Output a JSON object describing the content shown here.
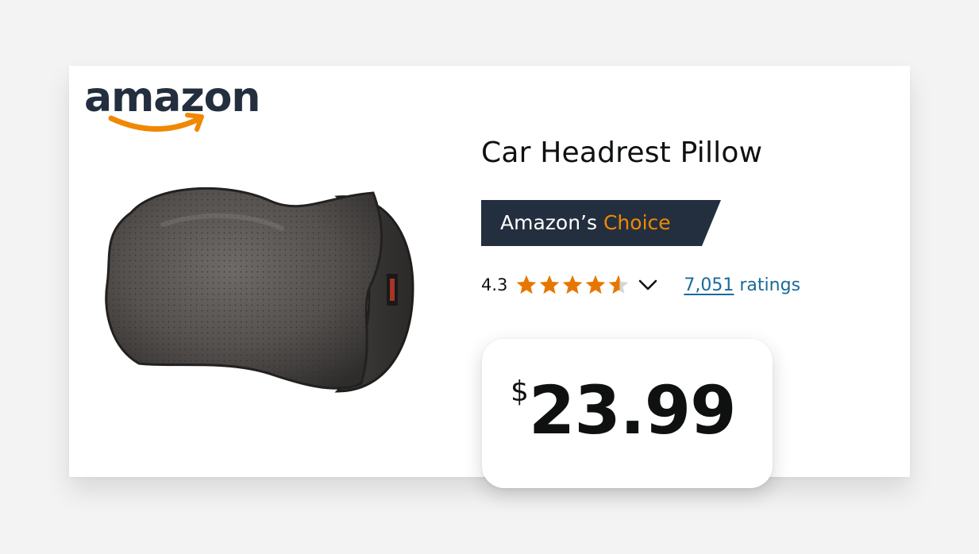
{
  "brand": {
    "logo_text": "amazon",
    "smile_color": "#f08804"
  },
  "product": {
    "title": "Car Headrest Pillow",
    "image_icon": "headrest-pillow-image"
  },
  "badge": {
    "prefix": "Amazon’s",
    "highlight": "Choice",
    "background_color": "#232f3e",
    "highlight_color": "#f08804"
  },
  "rating": {
    "value": "4.3",
    "stars_out_of_5": 4.3,
    "star_color": "#e77600",
    "dropdown_icon": "chevron-down-icon",
    "count": "7,051",
    "count_suffix": "ratings"
  },
  "price": {
    "currency": "$",
    "amount": "23.99"
  }
}
